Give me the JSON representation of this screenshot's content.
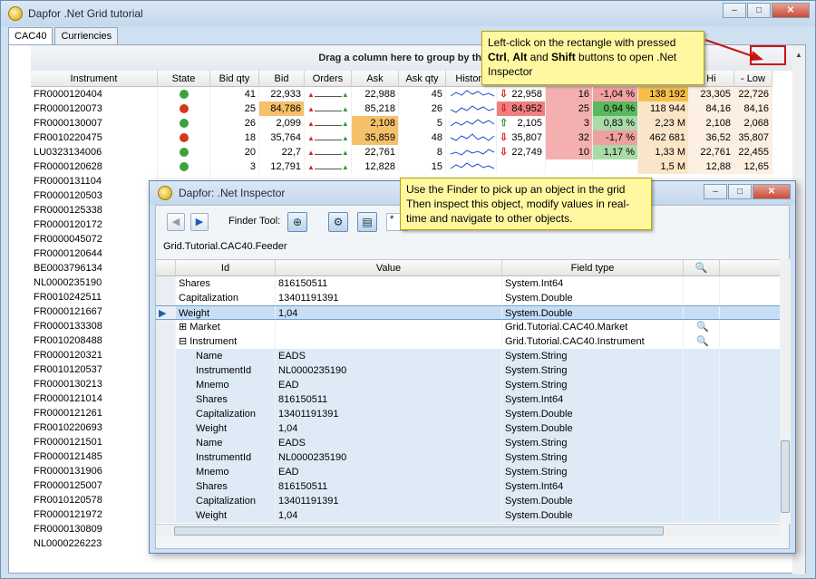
{
  "window": {
    "title": "Dapfor .Net Grid tutorial",
    "min": "–",
    "max": "□",
    "close": "✕"
  },
  "tabs": [
    "CAC40",
    "Curriencies"
  ],
  "grid": {
    "group_panel": "Drag a column here to group by that co",
    "columns": [
      "Instrument",
      "State",
      "Bid qty",
      "Bid",
      "Orders",
      "Ask",
      "Ask qty",
      "History",
      "",
      "",
      "",
      "",
      "",
      "Hi",
      "- Low"
    ],
    "rows": [
      {
        "instrument": "FR0000120404",
        "state": "green",
        "bidqty": "41",
        "bid": "22,933",
        "bidhl": "",
        "ask": "22,988",
        "askhl": "",
        "askqty": "45",
        "dir": "down",
        "last": "22,958",
        "lasthl": "",
        "vol": "16",
        "chg": "-1,04 %",
        "chgbg": "#f0a0a0",
        "cap": "138 192",
        "capbg": "#f5c04a",
        "hi": "23,305",
        "low": "22,726"
      },
      {
        "instrument": "FR0000120073",
        "state": "red",
        "bidqty": "25",
        "bid": "84,786",
        "bidhl": "#f5c06a",
        "ask": "85,218",
        "askhl": "",
        "askqty": "26",
        "dir": "down",
        "last": "84,952",
        "lasthl": "#f08080",
        "vol": "25",
        "chg": "0,94 %",
        "chgbg": "#5cb85c",
        "cap": "118 944",
        "capbg": "#fbe5c8",
        "hi": "84,16",
        "low": "84,16"
      },
      {
        "instrument": "FR0000130007",
        "state": "green",
        "bidqty": "26",
        "bid": "2,099",
        "bidhl": "",
        "ask": "2,108",
        "askhl": "#f5c06a",
        "askqty": "5",
        "dir": "up",
        "last": "2,105",
        "lasthl": "",
        "vol": "3",
        "chg": "0,83 %",
        "chgbg": "#a9dba9",
        "cap": "2,23 M",
        "capbg": "#fbe5c8",
        "hi": "2,108",
        "low": "2,068"
      },
      {
        "instrument": "FR0010220475",
        "state": "red",
        "bidqty": "18",
        "bid": "35,764",
        "bidhl": "",
        "ask": "35,859",
        "askhl": "#f5c06a",
        "askqty": "48",
        "dir": "down",
        "last": "35,807",
        "lasthl": "",
        "vol": "32",
        "chg": "-1,7 %",
        "chgbg": "#f0a0a0",
        "cap": "462 681",
        "capbg": "#fbe5c8",
        "hi": "36,52",
        "low": "35,807"
      },
      {
        "instrument": "LU0323134006",
        "state": "green",
        "bidqty": "20",
        "bid": "22,7",
        "bidhl": "",
        "ask": "22,761",
        "askhl": "",
        "askqty": "8",
        "dir": "down",
        "last": "22,749",
        "lasthl": "",
        "vol": "10",
        "chg": "1,17 %",
        "chgbg": "#a9dba9",
        "cap": "1,33 M",
        "capbg": "#fbe5c8",
        "hi": "22,761",
        "low": "22,455"
      },
      {
        "instrument": "FR0000120628",
        "state": "green",
        "bidqty": "3",
        "bid": "12,791",
        "bidhl": "",
        "ask": "12,828",
        "askhl": "",
        "askqty": "15",
        "dir": "",
        "last": "",
        "lasthl": "",
        "vol": "",
        "chg": "",
        "chgbg": "",
        "cap": "1,5 M",
        "capbg": "#fbe5c8",
        "hi": "12,88",
        "low": "12,65"
      },
      {
        "instrument": "FR0000131104",
        "state": "",
        "bidqty": "",
        "bid": "",
        "bidhl": "",
        "ask": "",
        "askhl": "",
        "askqty": "",
        "dir": "",
        "last": "",
        "lasthl": "",
        "vol": "",
        "chg": "",
        "chgbg": "",
        "cap": "",
        "capbg": "",
        "hi": "",
        "low": ""
      },
      {
        "instrument": "FR0000120503",
        "state": ""
      },
      {
        "instrument": "FR0000125338",
        "state": ""
      },
      {
        "instrument": "FR0000120172",
        "state": ""
      },
      {
        "instrument": "FR0000045072",
        "state": ""
      },
      {
        "instrument": "FR0000120644",
        "state": ""
      },
      {
        "instrument": "BE0003796134",
        "state": ""
      },
      {
        "instrument": "NL0000235190",
        "state": ""
      },
      {
        "instrument": "FR0010242511",
        "state": ""
      },
      {
        "instrument": "FR0000121667",
        "state": ""
      },
      {
        "instrument": "FR0000133308",
        "state": ""
      },
      {
        "instrument": "FR0010208488",
        "state": ""
      },
      {
        "instrument": "FR0000120321",
        "state": ""
      },
      {
        "instrument": "FR0010120537",
        "state": ""
      },
      {
        "instrument": "FR0000130213",
        "state": ""
      },
      {
        "instrument": "FR0000121014",
        "state": ""
      },
      {
        "instrument": "FR0000121261",
        "state": ""
      },
      {
        "instrument": "FR0010220693",
        "state": ""
      },
      {
        "instrument": "FR0000121501",
        "state": ""
      },
      {
        "instrument": "FR0000121485",
        "state": ""
      },
      {
        "instrument": "FR0000131906",
        "state": ""
      },
      {
        "instrument": "FR0000125007",
        "state": ""
      },
      {
        "instrument": "FR0010120578",
        "state": ""
      },
      {
        "instrument": "FR0000121972",
        "state": ""
      },
      {
        "instrument": "FR0000130809",
        "state": ""
      },
      {
        "instrument": "NL0000226223",
        "state": ""
      }
    ]
  },
  "callout_top": {
    "line1": "Left-click on the rectangle with pressed",
    "ctrl": "Ctrl",
    "sep1": ", ",
    "alt": "Alt",
    "sep2": " and ",
    "shift": "Shift",
    "line2_end": " buttons to open .Net",
    "line3": "Inspector"
  },
  "callout_finder": {
    "line1": "Use the Finder to pick up an object in the grid",
    "line2": "Then inspect this object, modify values in real-",
    "line3": "time and navigate to other objects."
  },
  "inspector": {
    "title": "Dapfor: .Net Inspector",
    "finder_label": "Finder Tool:",
    "search_value": "*",
    "path": "Grid.Tutorial.CAC40.Feeder",
    "columns": [
      "Id",
      "Value",
      "Field type"
    ],
    "rows": [
      {
        "id": "Shares",
        "value": "816150511",
        "type": "System.Int64",
        "level": 0,
        "marker": "",
        "expand": "",
        "search": false
      },
      {
        "id": "Capitalization",
        "value": "13401191391",
        "type": "System.Double",
        "level": 0,
        "marker": "",
        "expand": "",
        "search": false
      },
      {
        "id": "Weight",
        "value": "1,04",
        "type": "System.Double",
        "level": 0,
        "marker": "▶",
        "expand": "",
        "search": false
      },
      {
        "id": "Market",
        "value": "",
        "type": "Grid.Tutorial.CAC40.Market",
        "level": 0,
        "marker": "",
        "expand": "⊞",
        "search": true
      },
      {
        "id": "Instrument",
        "value": "",
        "type": "Grid.Tutorial.CAC40.Instrument",
        "level": 0,
        "marker": "",
        "expand": "⊟",
        "search": true
      },
      {
        "id": "Name",
        "value": "EADS",
        "type": "System.String",
        "level": 1
      },
      {
        "id": "InstrumentId",
        "value": "NL0000235190",
        "type": "System.String",
        "level": 1
      },
      {
        "id": "Mnemo",
        "value": "EAD",
        "type": "System.String",
        "level": 1
      },
      {
        "id": "Shares",
        "value": "816150511",
        "type": "System.Int64",
        "level": 1
      },
      {
        "id": "Capitalization",
        "value": "13401191391",
        "type": "System.Double",
        "level": 1
      },
      {
        "id": "Weight",
        "value": "1,04",
        "type": "System.Double",
        "level": 1
      },
      {
        "id": "Name",
        "value": "EADS",
        "type": "System.String",
        "level": 1
      },
      {
        "id": "InstrumentId",
        "value": "NL0000235190",
        "type": "System.String",
        "level": 1
      },
      {
        "id": "Mnemo",
        "value": "EAD",
        "type": "System.String",
        "level": 1
      },
      {
        "id": "Shares",
        "value": "816150511",
        "type": "System.Int64",
        "level": 1
      },
      {
        "id": "Capitalization",
        "value": "13401191391",
        "type": "System.Double",
        "level": 1
      },
      {
        "id": "Weight",
        "value": "1,04",
        "type": "System.Double",
        "level": 1
      }
    ]
  },
  "colors": {
    "accent": "#3399ff",
    "green_state": "#3aa33a",
    "red_state": "#d03a1a",
    "callout_bg": "#fff8a0",
    "highlight_red": "#d01010"
  }
}
